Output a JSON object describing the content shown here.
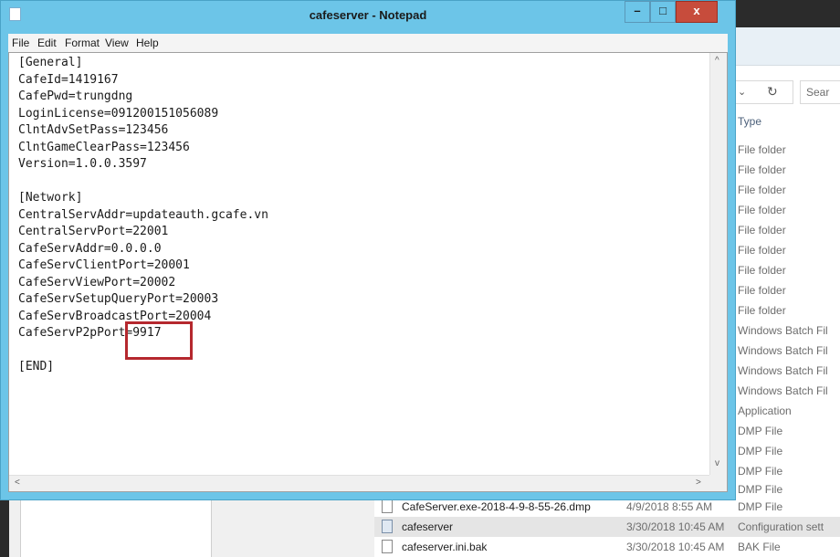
{
  "notepad": {
    "title": "cafeserver - Notepad",
    "window_controls": {
      "minimize": "–",
      "maximize": "□",
      "close": "x"
    },
    "menu": [
      "File",
      "Edit",
      "Format",
      "View",
      "Help"
    ],
    "lines": [
      "[General]",
      "CafeId=1419167",
      "CafePwd=trungdng",
      "LoginLicense=091200151056089",
      "ClntAdvSetPass=123456",
      "ClntGameClearPass=123456",
      "Version=1.0.0.3597",
      "",
      "[Network]",
      "CentralServAddr=updateauth.gcafe.vn",
      "CentralServPort=22001",
      "CafeServAddr=0.0.0.0",
      "CafeServClientPort=20001",
      "CafeServViewPort=20002",
      "CafeServSetupQueryPort=20003",
      "CafeServBroadcastPort=20004",
      "CafeServP2pPort=9917",
      "",
      "[END]"
    ],
    "scroll": {
      "up": "^",
      "down": "v",
      "left": "<",
      "right": ">"
    }
  },
  "explorer": {
    "search_placeholder": "Sear",
    "column_type": "Type",
    "type_list": [
      "File folder",
      "File folder",
      "File folder",
      "File folder",
      "File folder",
      "File folder",
      "File folder",
      "File folder",
      "File folder",
      "Windows Batch Fil",
      "Windows Batch Fil",
      "Windows Batch Fil",
      "Windows Batch Fil",
      "Application",
      "DMP File",
      "DMP File",
      "DMP File",
      "DMP File"
    ],
    "files": [
      {
        "name": "CafeServer.exe-2018-4-9-8-55-26.dmp",
        "date": "4/9/2018 8:55 AM",
        "type": "DMP File"
      },
      {
        "name": "cafeserver",
        "date": "3/30/2018 10:45 AM",
        "type": "Configuration sett"
      },
      {
        "name": "cafeserver.ini.bak",
        "date": "3/30/2018 10:45 AM",
        "type": "BAK File"
      }
    ]
  }
}
